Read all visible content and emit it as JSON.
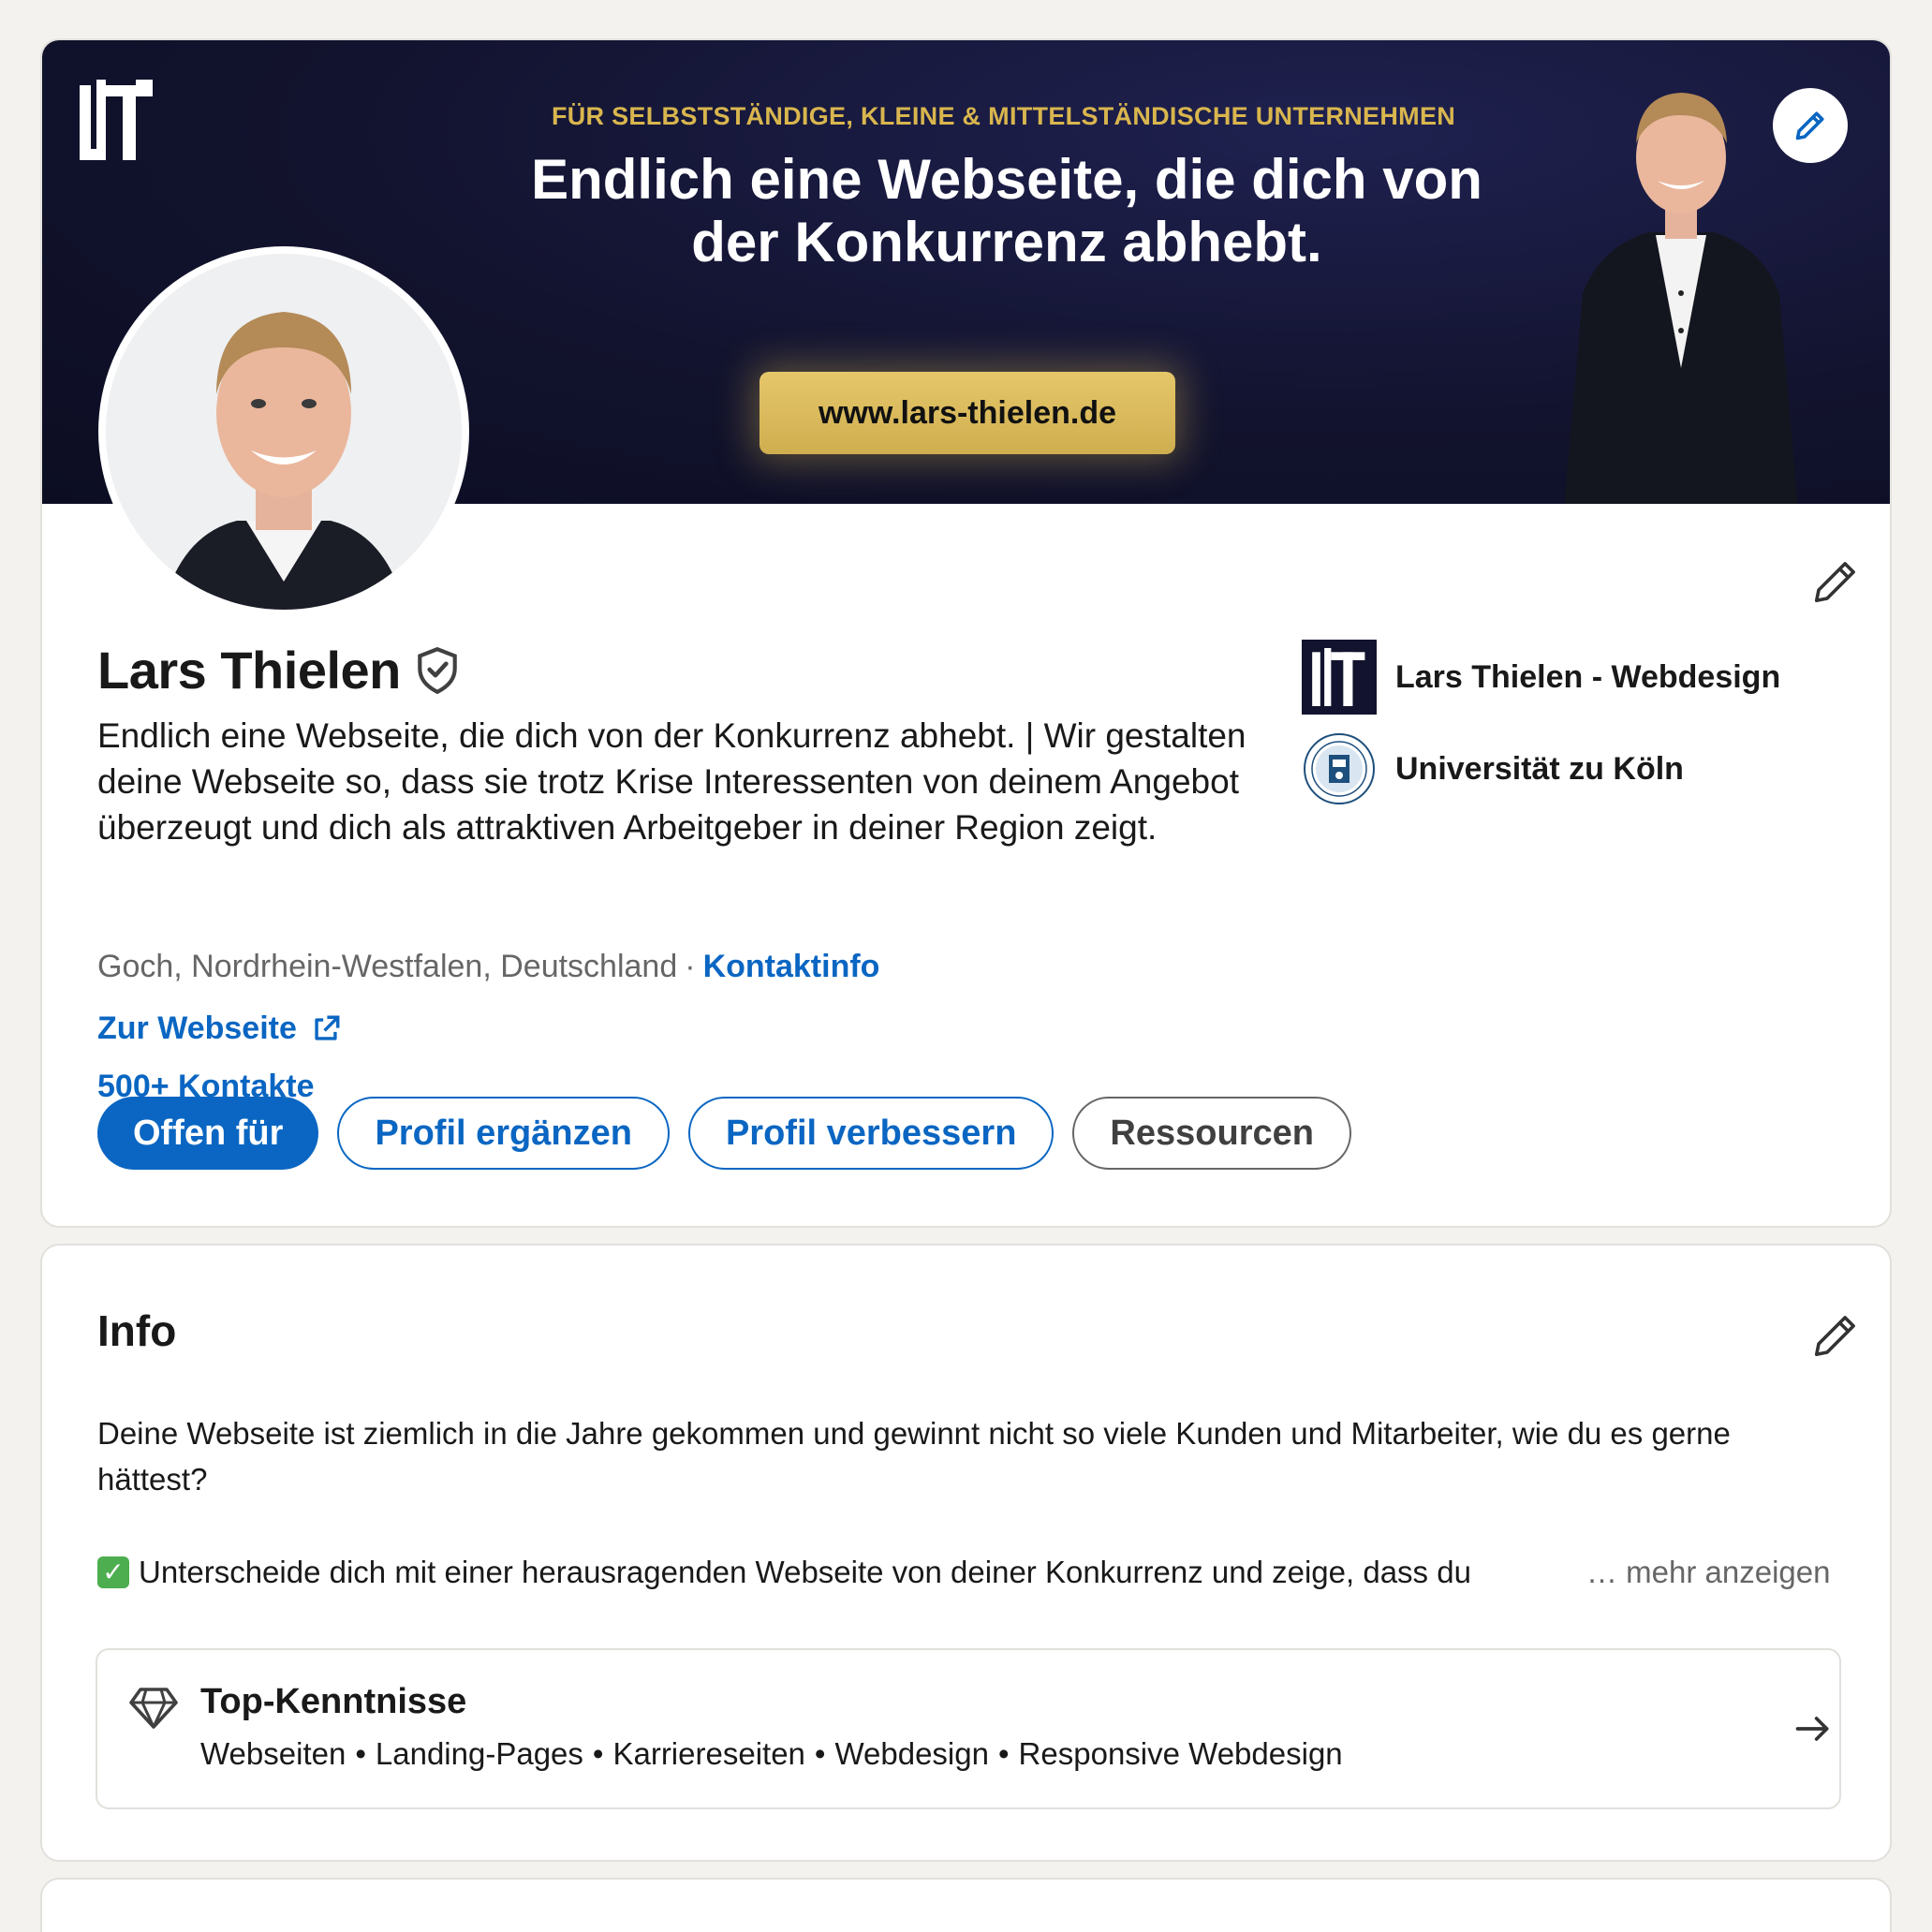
{
  "banner": {
    "tagline": "FÜR SELBSTSTÄNDIGE, KLEINE & MITTELSTÄNDISCHE UNTERNEHMEN",
    "headline": "Endlich eine Webseite, die dich von\nder Konkurrenz abhebt.",
    "cta": "www.lars-thielen.de",
    "logo_text": "LT"
  },
  "profile": {
    "name": "Lars Thielen",
    "headline": "Endlich eine Webseite, die dich von der Konkurrenz abhebt. | Wir gestalten deine Webseite so, dass sie trotz Krise Interessenten von deinem Angebot überzeugt und dich als attraktiven Arbeitgeber in deiner Region zeigt.",
    "location": "Goch, Nordrhein-Westfalen, Deutschland",
    "separator": "·",
    "contact_info": "Kontaktinfo",
    "website": "Zur Webseite",
    "connections": "500+ Kontakte",
    "buttons": {
      "open_to": "Offen für",
      "add_section": "Profil ergänzen",
      "enhance": "Profil verbessern",
      "resources": "Ressourcen"
    },
    "organizations": [
      {
        "name": "Lars Thielen - Webdesign",
        "icon": "lt-logo"
      },
      {
        "name": "Universität zu Köln",
        "icon": "university-seal"
      }
    ]
  },
  "info": {
    "title": "Info",
    "paragraph1": "Deine Webseite ist ziemlich in die Jahre gekommen und gewinnt nicht so viele Kunden und Mitarbeiter, wie du es gerne hättest?",
    "paragraph2": "Unterscheide dich mit einer herausragenden Webseite von deiner Konkurrenz und zeige, dass du",
    "show_more": "… mehr anzeigen",
    "top_skills": {
      "title": "Top-Kenntnisse",
      "skills": [
        "Webseiten",
        "Landing-Pages",
        "Karriereseiten",
        "Webdesign",
        "Responsive Webdesign"
      ],
      "separator": "•"
    }
  },
  "colors": {
    "accent": "#0a66c2",
    "banner_bg": "#12132e",
    "gold": "#d9b64e",
    "page_bg": "#f4f2ee"
  }
}
